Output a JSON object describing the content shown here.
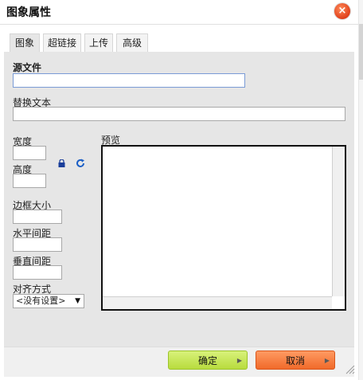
{
  "dialog": {
    "title": "图象属性",
    "close_glyph": "×"
  },
  "tabs": [
    {
      "label": "图象",
      "active": true
    },
    {
      "label": "超链接",
      "active": false
    },
    {
      "label": "上传",
      "active": false
    },
    {
      "label": "高级",
      "active": false
    }
  ],
  "form": {
    "source_label": "源文件",
    "source_value": "",
    "alt_label": "替换文本",
    "alt_value": "",
    "width_label": "宽度",
    "width_value": "",
    "height_label": "高度",
    "height_value": "",
    "border_label": "边框大小",
    "border_value": "",
    "hspace_label": "水平间距",
    "hspace_value": "",
    "vspace_label": "垂直间距",
    "vspace_value": "",
    "align_label": "对齐方式",
    "align_selected": "<没有设置>"
  },
  "preview": {
    "label": "预览"
  },
  "icons": {
    "lock": "lock-icon",
    "reset": "reset-size-icon",
    "close": "close-icon"
  },
  "buttons": {
    "ok": "确定",
    "cancel": "取消"
  },
  "colors": {
    "ok_button": "#b8dc3e",
    "cancel_button": "#f06a2a",
    "close_button": "#e0401a",
    "panel_bg": "#e6e6e6"
  }
}
